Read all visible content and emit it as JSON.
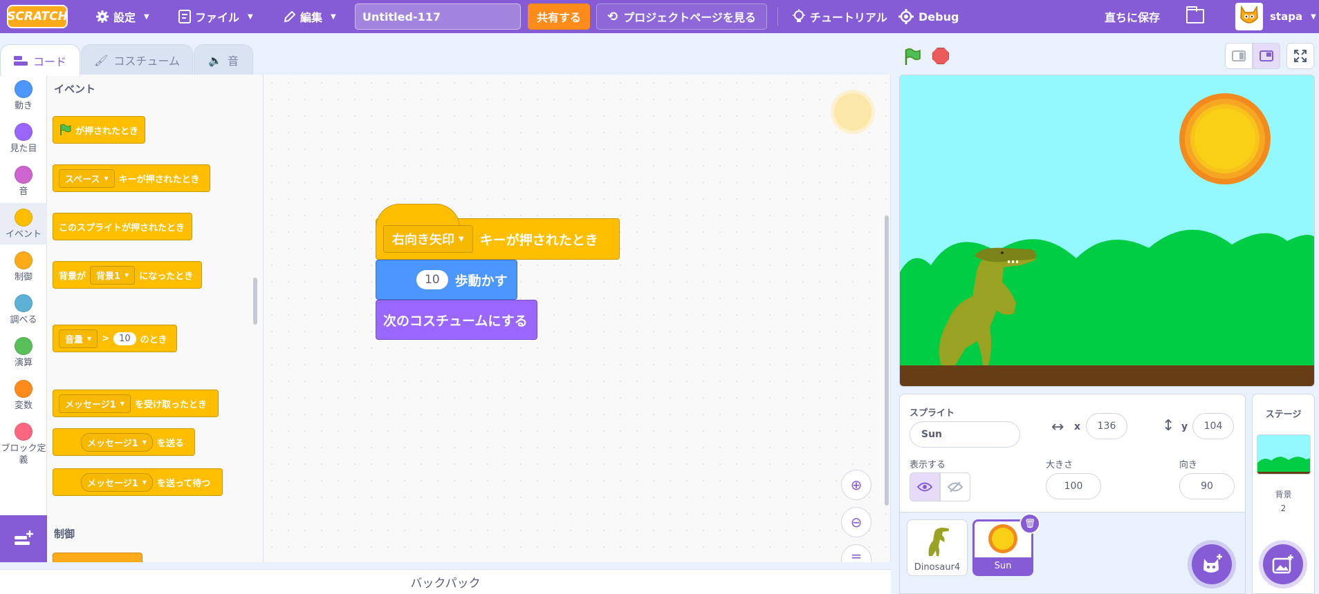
{
  "menubar": {
    "logo": "SCRATCH",
    "settings": "設定",
    "file": "ファイル",
    "edit": "編集",
    "project_title": "Untitled-117",
    "share": "共有する",
    "see_project_page": "プロジェクトページを見る",
    "tutorials": "チュートリアル",
    "debug": "Debug",
    "save_now": "直ちに保存",
    "username": "stapa"
  },
  "tabs": {
    "code": "コード",
    "costumes": "コスチューム",
    "sounds": "音"
  },
  "categories": [
    {
      "label": "動き",
      "color": "#4c97ff"
    },
    {
      "label": "見た目",
      "color": "#9966ff"
    },
    {
      "label": "音",
      "color": "#cf63cf"
    },
    {
      "label": "イベント",
      "color": "#ffbf00"
    },
    {
      "label": "制御",
      "color": "#ffab19"
    },
    {
      "label": "調べる",
      "color": "#5cb1d6"
    },
    {
      "label": "演算",
      "color": "#59c059"
    },
    {
      "label": "変数",
      "color": "#ff8c1a"
    },
    {
      "label": "ブロック定義",
      "color": "#ff6680"
    }
  ],
  "palette": {
    "section_events": "イベント",
    "section_control": "制御",
    "when_flag_clicked": "が押されたとき",
    "when_key_pressed_key": "スペース",
    "when_key_pressed_text": "キーが押されたとき",
    "when_sprite_clicked": "このスプライトが押されたとき",
    "when_backdrop_prefix": "背景が",
    "when_backdrop_value": "背景1",
    "when_backdrop_suffix": "になったとき",
    "when_loudness_menu": "音量",
    "when_loudness_op": ">",
    "when_loudness_value": "10",
    "when_loudness_suffix": "のとき",
    "when_receive_value": "メッセージ1",
    "when_receive_text": "を受け取ったとき",
    "broadcast_value": "メッセージ1",
    "broadcast_text": "を送る",
    "broadcast_wait_value": "メッセージ1",
    "broadcast_wait_text": "を送って待つ"
  },
  "script": {
    "hat_key": "右向き矢印",
    "hat_text": "キーが押されたとき",
    "move_steps": "10",
    "move_text": "歩動かす",
    "next_costume": "次のコスチュームにする"
  },
  "backpack": "バックパック",
  "sprite_info": {
    "sprite_label": "スプライト",
    "sprite_name": "Sun",
    "x_label": "x",
    "x_value": "136",
    "y_label": "y",
    "y_value": "104",
    "show_label": "表示する",
    "size_label": "大きさ",
    "size_value": "100",
    "direction_label": "向き",
    "direction_value": "90"
  },
  "sprites": [
    {
      "name": "Dinosaur4"
    },
    {
      "name": "Sun"
    }
  ],
  "stage_pane": {
    "title": "ステージ",
    "backdrops_label": "背景",
    "backdrops_count": "2"
  },
  "colors": {
    "accent": "#855cd6",
    "events": "#ffbf00",
    "motion": "#4c97ff",
    "looks": "#9966ff",
    "share": "#ff8c1a"
  }
}
